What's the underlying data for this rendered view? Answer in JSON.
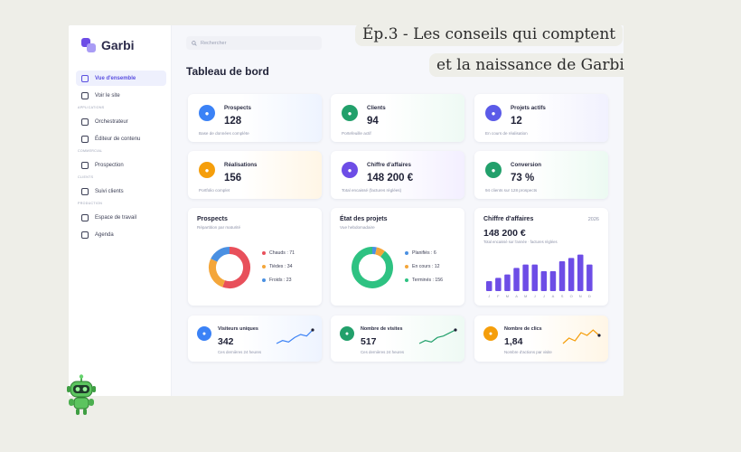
{
  "app": {
    "name": "Garbi"
  },
  "search": {
    "placeholder": "Rechercher"
  },
  "page_title": "Tableau de bord",
  "overlay": {
    "line1": "Ép.3 - Les conseils qui comptent",
    "line2": "et la naissance de Garbi"
  },
  "sidebar": {
    "items": [
      {
        "label": "Vue d'ensemble",
        "icon": "grid-icon",
        "active": true
      },
      {
        "label": "Voir le site",
        "icon": "globe-icon"
      }
    ],
    "sections": [
      {
        "title": "APPLICATIONS",
        "items": [
          {
            "label": "Orchestrateur",
            "icon": "nodes-icon"
          },
          {
            "label": "Éditeur de contenu",
            "icon": "edit-icon"
          }
        ]
      },
      {
        "title": "COMMERCIAL",
        "items": [
          {
            "label": "Prospection",
            "icon": "user-search-icon"
          }
        ]
      },
      {
        "title": "CLIENTS",
        "items": [
          {
            "label": "Suivi clients",
            "icon": "user-icon"
          }
        ]
      },
      {
        "title": "PRODUCTION",
        "items": [
          {
            "label": "Espace de travail",
            "icon": "building-icon"
          },
          {
            "label": "Agenda",
            "icon": "calendar-icon"
          }
        ]
      }
    ]
  },
  "kpis": [
    {
      "label": "Prospects",
      "value": "128",
      "sub": "Base de données complète",
      "color": "#3b82f6",
      "icon": "users-icon"
    },
    {
      "label": "Clients",
      "value": "94",
      "sub": "Portefeuille actif",
      "color": "#22a06b",
      "icon": "clipboard-icon"
    },
    {
      "label": "Projets actifs",
      "value": "12",
      "sub": "En cours de réalisation",
      "color": "#5b5be8",
      "icon": "briefcase-icon"
    },
    {
      "label": "Réalisations",
      "value": "156",
      "sub": "Portfolio complet",
      "color": "#f59e0b",
      "icon": "image-icon"
    },
    {
      "label": "Chiffre d'affaires",
      "value": "148 200 €",
      "sub": "Total encaissé (factures réglées)",
      "color": "#6d4de6",
      "icon": "money-icon"
    },
    {
      "label": "Conversion",
      "value": "73 %",
      "sub": "94 clients sur 128 prospects",
      "color": "#22a06b",
      "icon": "target-icon"
    }
  ],
  "prospects_panel": {
    "title": "Prospects",
    "subtitle": "Répartition par maturité",
    "legend": [
      {
        "label": "Chauds : 71",
        "color": "#e8505b"
      },
      {
        "label": "Tièdes : 34",
        "color": "#f4a63a"
      },
      {
        "label": "Froids : 23",
        "color": "#4a90e2"
      }
    ]
  },
  "projects_panel": {
    "title": "État des projets",
    "subtitle": "Vue hebdomadaire",
    "legend": [
      {
        "label": "Planifiés : 6",
        "color": "#4a90e2"
      },
      {
        "label": "En cours : 12",
        "color": "#f4a63a"
      },
      {
        "label": "Terminés : 156",
        "color": "#2ec282"
      }
    ]
  },
  "revenue_panel": {
    "title": "Chiffre d'affaires",
    "year": "2026",
    "value": "148 200 €",
    "subtitle": "Total encaissé sur l'année · factures réglées"
  },
  "bottom": [
    {
      "label": "Visiteurs uniques",
      "value": "342",
      "sub": "Ces dernières 24 heures",
      "color": "#3b82f6",
      "icon": "visitor-icon",
      "spark": [
        4,
        6,
        5,
        8,
        10,
        9,
        13
      ]
    },
    {
      "label": "Nombre de visites",
      "value": "517",
      "sub": "Ces dernières 24 heures",
      "color": "#22a06b",
      "icon": "person-icon",
      "spark": [
        3,
        5,
        4,
        7,
        8,
        10,
        12
      ]
    },
    {
      "label": "Nombre de clics",
      "value": "1,84",
      "sub": "Nombre d'actions par visite",
      "color": "#f59e0b",
      "icon": "click-icon",
      "spark": [
        6,
        8,
        7,
        10,
        9,
        11,
        9
      ]
    }
  ],
  "chart_data": [
    {
      "type": "pie",
      "title": "Prospects",
      "categories": [
        "Chauds",
        "Tièdes",
        "Froids"
      ],
      "values": [
        71,
        34,
        23
      ],
      "colors": [
        "#e8505b",
        "#f4a63a",
        "#4a90e2"
      ]
    },
    {
      "type": "pie",
      "title": "État des projets",
      "categories": [
        "Planifiés",
        "En cours",
        "Terminés"
      ],
      "values": [
        6,
        12,
        156
      ],
      "colors": [
        "#4a90e2",
        "#f4a63a",
        "#2ec282"
      ]
    },
    {
      "type": "bar",
      "title": "Chiffre d'affaires",
      "categories": [
        "J",
        "F",
        "M",
        "A",
        "M",
        "J",
        "J",
        "A",
        "S",
        "O",
        "N",
        "D"
      ],
      "values": [
        3,
        4,
        5,
        7,
        8,
        8,
        6,
        6,
        9,
        10,
        11,
        8
      ],
      "color": "#6d4de6"
    }
  ]
}
